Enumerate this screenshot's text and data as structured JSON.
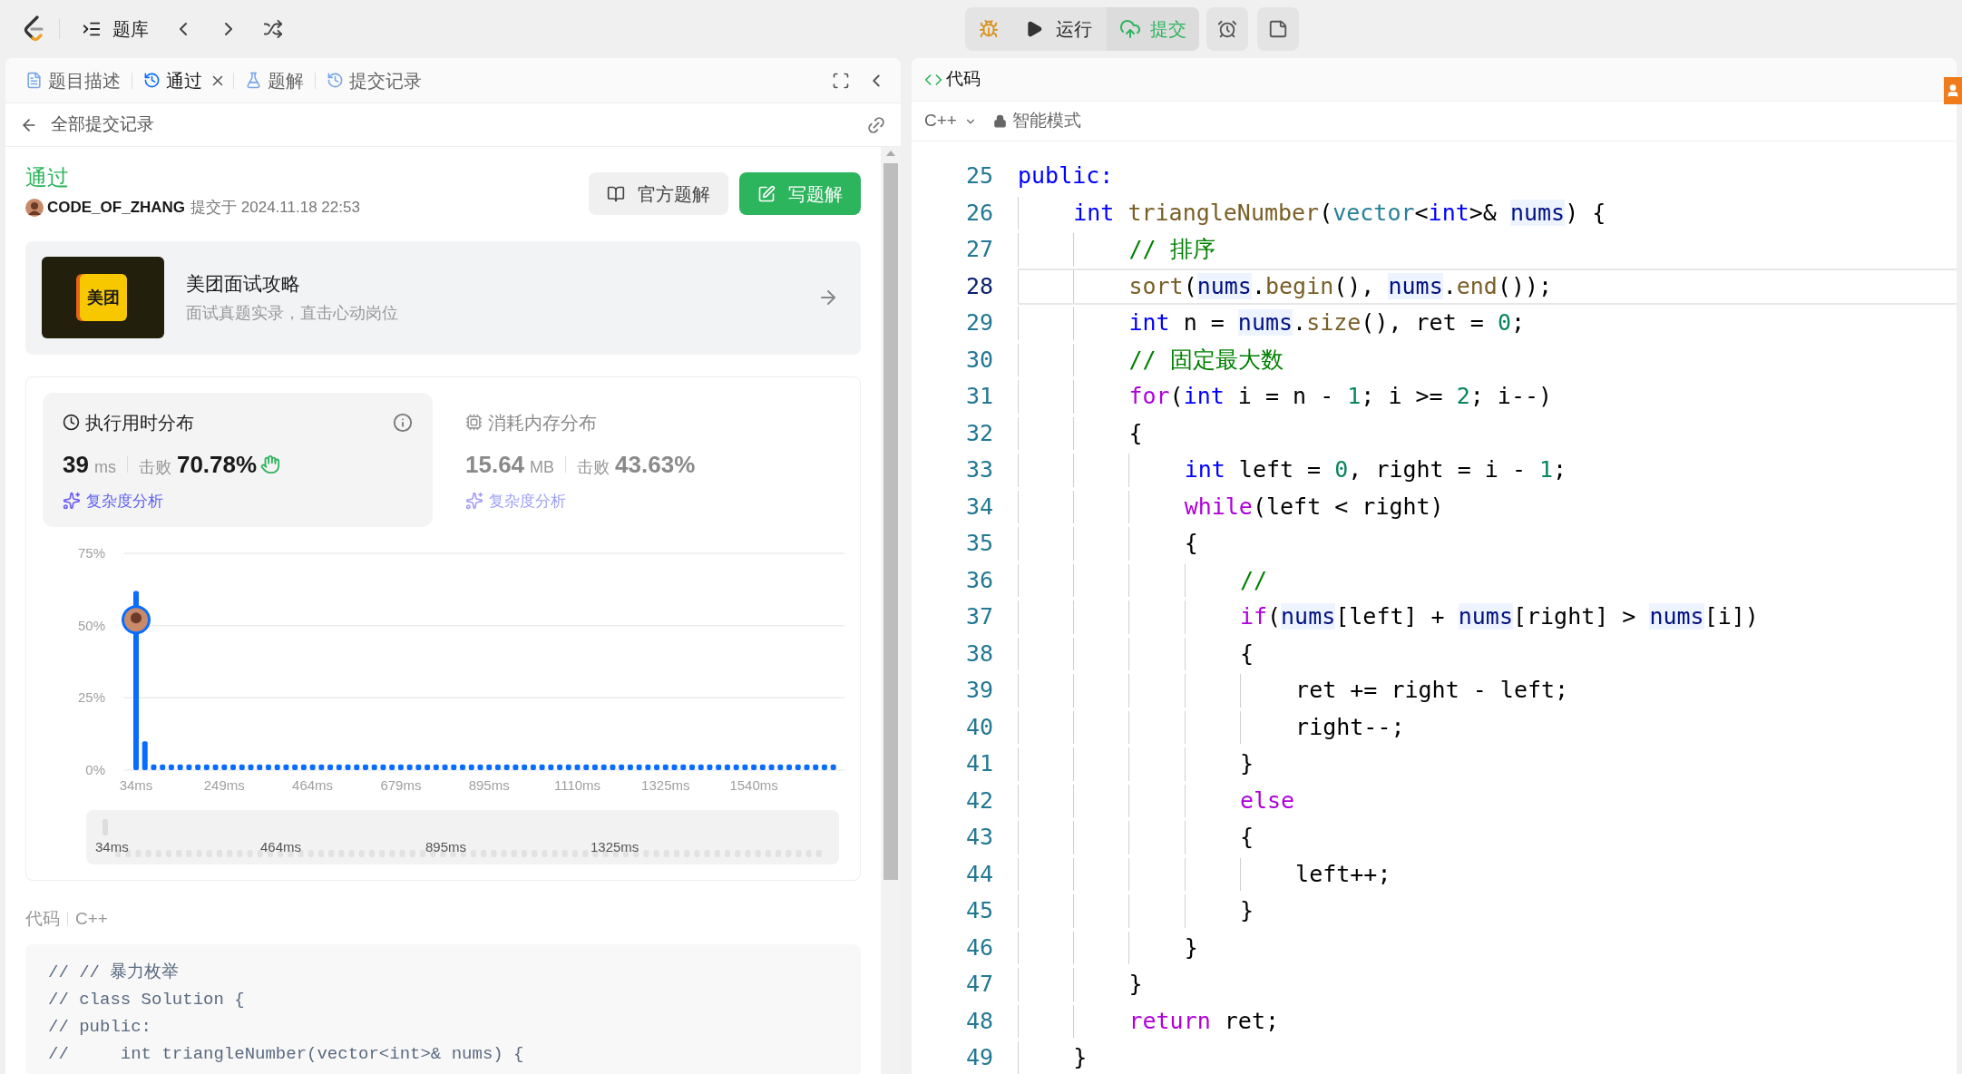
{
  "top_bar": {
    "problem_list": "题库",
    "run": "运行",
    "submit": "提交"
  },
  "left_tabs": [
    {
      "label": "题目描述",
      "kind": "description",
      "selected": false,
      "closable": false
    },
    {
      "label": "通过",
      "kind": "result",
      "selected": true,
      "closable": true
    },
    {
      "label": "题解",
      "kind": "solutions",
      "selected": false,
      "closable": false
    },
    {
      "label": "提交记录",
      "kind": "submissions",
      "selected": false,
      "closable": false
    }
  ],
  "back_link": "全部提交记录",
  "submission": {
    "status": "通过",
    "user": "CODE_OF_ZHANG",
    "submitted_at": "提交于 2024.11.18 22:53",
    "buttons": [
      {
        "label": "官方题解",
        "kind": "secondary"
      },
      {
        "label": "写题解",
        "kind": "primary"
      }
    ]
  },
  "promo": {
    "logo_text": "美团",
    "title": "美团面试攻略",
    "subtitle": "面试真题实录，直击心动岗位"
  },
  "metrics": [
    {
      "kind": "time",
      "title": "执行用时分布",
      "value": "39",
      "unit": "ms",
      "beat_label": "击败",
      "beat": "70.78%",
      "link": "复杂度分析",
      "selected": true
    },
    {
      "kind": "memory",
      "title": "消耗内存分布",
      "value": "15.64",
      "unit": "MB",
      "beat_label": "击败",
      "beat": "43.63%",
      "link": "复杂度分析",
      "selected": false
    }
  ],
  "chart_data": {
    "type": "bar",
    "ylim": [
      0,
      75
    ],
    "yticks": [
      {
        "value": 0,
        "label": "0%"
      },
      {
        "value": 25,
        "label": "25%"
      },
      {
        "value": 50,
        "label": "50%"
      },
      {
        "value": 75,
        "label": "75%"
      }
    ],
    "categories": [
      "34ms",
      null,
      null,
      null,
      null,
      null,
      null,
      null,
      null,
      null,
      "249ms",
      null,
      null,
      null,
      null,
      null,
      null,
      null,
      null,
      null,
      "464ms",
      null,
      null,
      null,
      null,
      null,
      null,
      null,
      null,
      null,
      "679ms",
      null,
      null,
      null,
      null,
      null,
      null,
      null,
      null,
      null,
      "895ms",
      null,
      null,
      null,
      null,
      null,
      null,
      null,
      null,
      null,
      "1110ms",
      null,
      null,
      null,
      null,
      null,
      null,
      null,
      null,
      null,
      "1325ms",
      null,
      null,
      null,
      null,
      null,
      null,
      null,
      null,
      null,
      "1540ms",
      null,
      null,
      null,
      null,
      null,
      null,
      null,
      null,
      null
    ],
    "values": [
      62,
      10,
      2,
      2,
      2,
      2,
      2,
      2,
      2,
      2,
      2,
      2,
      2,
      2,
      2,
      2,
      2,
      2,
      2,
      2,
      2,
      2,
      2,
      2,
      2,
      2,
      2,
      2,
      2,
      2,
      2,
      2,
      2,
      2,
      2,
      2,
      2,
      2,
      2,
      2,
      2,
      2,
      2,
      2,
      2,
      2,
      2,
      2,
      2,
      2,
      2,
      2,
      2,
      2,
      2,
      2,
      2,
      2,
      2,
      2,
      2,
      2,
      2,
      2,
      2,
      2,
      2,
      2,
      2,
      2,
      2,
      2,
      2,
      2,
      2,
      2,
      2,
      2,
      2,
      2
    ]
  },
  "range_slider": {
    "labels": [
      "34ms",
      "464ms",
      "895ms",
      "1325ms"
    ],
    "level": 1
  },
  "code_section": {
    "label": "代码",
    "language": "C++",
    "lines": [
      "// // 暴力枚举",
      "// class Solution {",
      "// public:",
      "//     int triangleNumber(vector<int>& nums) {"
    ]
  },
  "editor": {
    "tab": "代码",
    "language": "C++",
    "mode": "智能模式",
    "lines": [
      {
        "no": "25",
        "selected": false,
        "tokens": [
          {
            "kind": "keyword",
            "text": "public:"
          }
        ]
      },
      {
        "no": "26",
        "selected": false,
        "tokens": [
          {
            "kind": "keyword",
            "text": "    int"
          },
          {
            "kind": "function",
            "text": " triangleNumber"
          },
          {
            "kind": "plain",
            "text": "("
          },
          {
            "kind": "type",
            "text": "vector"
          },
          {
            "kind": "plain",
            "text": "<"
          },
          {
            "kind": "keyword",
            "text": "int"
          },
          {
            "kind": "plain",
            "text": ">& "
          },
          {
            "kind": "variable",
            "text": "nums"
          },
          {
            "kind": "plain",
            "text": ") {"
          }
        ]
      },
      {
        "no": "27",
        "selected": false,
        "tokens": [
          {
            "kind": "comment",
            "text": "        // 排序"
          }
        ]
      },
      {
        "no": "28",
        "selected": true,
        "tokens": [
          {
            "kind": "function",
            "text": "        sort"
          },
          {
            "kind": "plain",
            "text": "("
          },
          {
            "kind": "variable",
            "text": "nums"
          },
          {
            "kind": "plain",
            "text": "."
          },
          {
            "kind": "function",
            "text": "begin"
          },
          {
            "kind": "plain",
            "text": "(), "
          },
          {
            "kind": "variable",
            "text": "nums"
          },
          {
            "kind": "plain",
            "text": "."
          },
          {
            "kind": "function",
            "text": "end"
          },
          {
            "kind": "plain",
            "text": "());"
          }
        ]
      },
      {
        "no": "29",
        "selected": false,
        "tokens": [
          {
            "kind": "keyword",
            "text": "        int"
          },
          {
            "kind": "plain",
            "text": " n = "
          },
          {
            "kind": "variable",
            "text": "nums"
          },
          {
            "kind": "plain",
            "text": "."
          },
          {
            "kind": "function",
            "text": "size"
          },
          {
            "kind": "plain",
            "text": "(), ret = "
          },
          {
            "kind": "number",
            "text": "0"
          },
          {
            "kind": "plain",
            "text": ";"
          }
        ]
      },
      {
        "no": "30",
        "selected": false,
        "tokens": [
          {
            "kind": "comment",
            "text": "        // 固定最大数"
          }
        ]
      },
      {
        "no": "31",
        "selected": false,
        "tokens": [
          {
            "kind": "control",
            "text": "        for"
          },
          {
            "kind": "plain",
            "text": "("
          },
          {
            "kind": "keyword",
            "text": "int"
          },
          {
            "kind": "plain",
            "text": " i = n - "
          },
          {
            "kind": "number",
            "text": "1"
          },
          {
            "kind": "plain",
            "text": "; i >= "
          },
          {
            "kind": "number",
            "text": "2"
          },
          {
            "kind": "plain",
            "text": "; i--)"
          }
        ]
      },
      {
        "no": "32",
        "selected": false,
        "tokens": [
          {
            "kind": "plain",
            "text": "        {"
          }
        ]
      },
      {
        "no": "33",
        "selected": false,
        "tokens": [
          {
            "kind": "keyword",
            "text": "            int"
          },
          {
            "kind": "plain",
            "text": " left = "
          },
          {
            "kind": "number",
            "text": "0"
          },
          {
            "kind": "plain",
            "text": ", right = i - "
          },
          {
            "kind": "number",
            "text": "1"
          },
          {
            "kind": "plain",
            "text": ";"
          }
        ]
      },
      {
        "no": "34",
        "selected": false,
        "tokens": [
          {
            "kind": "control",
            "text": "            while"
          },
          {
            "kind": "plain",
            "text": "(left < right)"
          }
        ]
      },
      {
        "no": "35",
        "selected": false,
        "tokens": [
          {
            "kind": "plain",
            "text": "            {"
          }
        ]
      },
      {
        "no": "36",
        "selected": false,
        "tokens": [
          {
            "kind": "comment",
            "text": "                //"
          }
        ]
      },
      {
        "no": "37",
        "selected": false,
        "tokens": [
          {
            "kind": "control",
            "text": "                if"
          },
          {
            "kind": "plain",
            "text": "("
          },
          {
            "kind": "variable",
            "text": "nums"
          },
          {
            "kind": "plain",
            "text": "[left] + "
          },
          {
            "kind": "variable",
            "text": "nums"
          },
          {
            "kind": "plain",
            "text": "[right] > "
          },
          {
            "kind": "variable",
            "text": "nums"
          },
          {
            "kind": "plain",
            "text": "[i])"
          }
        ]
      },
      {
        "no": "38",
        "selected": false,
        "tokens": [
          {
            "kind": "plain",
            "text": "                {"
          }
        ]
      },
      {
        "no": "39",
        "selected": false,
        "tokens": [
          {
            "kind": "plain",
            "text": "                    ret += right - left;"
          }
        ]
      },
      {
        "no": "40",
        "selected": false,
        "tokens": [
          {
            "kind": "plain",
            "text": "                    right--;"
          }
        ]
      },
      {
        "no": "41",
        "selected": false,
        "tokens": [
          {
            "kind": "plain",
            "text": "                }"
          }
        ]
      },
      {
        "no": "42",
        "selected": false,
        "tokens": [
          {
            "kind": "control",
            "text": "                else"
          }
        ]
      },
      {
        "no": "43",
        "selected": false,
        "tokens": [
          {
            "kind": "plain",
            "text": "                {"
          }
        ]
      },
      {
        "no": "44",
        "selected": false,
        "tokens": [
          {
            "kind": "plain",
            "text": "                    left++;"
          }
        ]
      },
      {
        "no": "45",
        "selected": false,
        "tokens": [
          {
            "kind": "plain",
            "text": "                }"
          }
        ]
      },
      {
        "no": "46",
        "selected": false,
        "tokens": [
          {
            "kind": "plain",
            "text": "            }"
          }
        ]
      },
      {
        "no": "47",
        "selected": false,
        "tokens": [
          {
            "kind": "plain",
            "text": "        }"
          }
        ]
      },
      {
        "no": "48",
        "selected": false,
        "tokens": [
          {
            "kind": "control",
            "text": "        return"
          },
          {
            "kind": "plain",
            "text": " ret;"
          }
        ]
      },
      {
        "no": "49",
        "selected": false,
        "tokens": [
          {
            "kind": "plain",
            "text": "    }"
          }
        ]
      }
    ]
  }
}
